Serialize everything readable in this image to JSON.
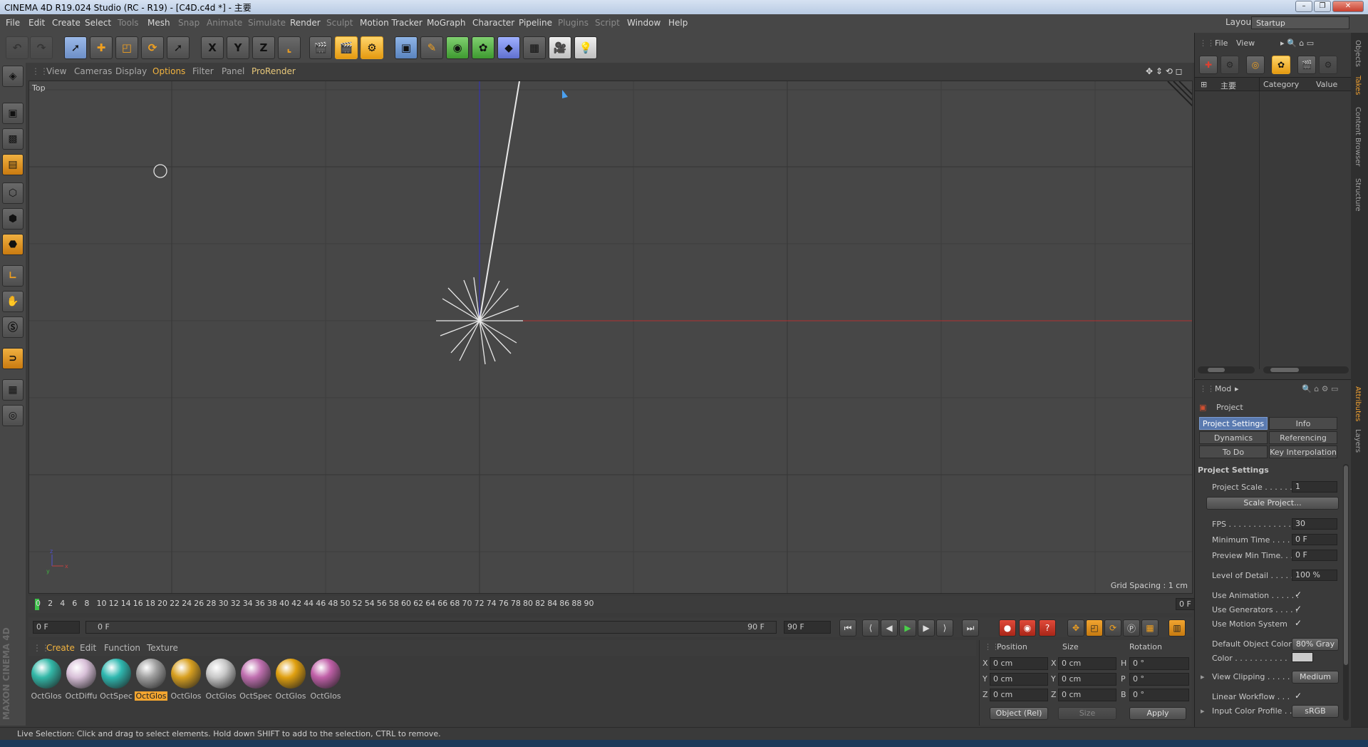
{
  "window": {
    "title": "CINEMA 4D R19.024 Studio (RC - R19) - [C4D.c4d *] - 主要"
  },
  "menu": [
    "File",
    "Edit",
    "Create",
    "Select",
    "Tools",
    "Mesh",
    "Snap",
    "Animate",
    "Simulate",
    "Render",
    "Sculpt",
    "Motion Tracker",
    "MoGraph",
    "Character",
    "Pipeline",
    "Plugins",
    "Script",
    "Window",
    "Help"
  ],
  "layout": {
    "label": "Layout:",
    "value": "Startup"
  },
  "toolbar": {
    "x": "X",
    "y": "Y",
    "z": "Z"
  },
  "viewport": {
    "menu": [
      "View",
      "Cameras",
      "Display",
      "Options",
      "Filter",
      "Panel",
      "ProRender"
    ],
    "label": "Top",
    "grid_spacing": "Grid Spacing : 1 cm",
    "axis_x_color": "#b03030",
    "axis_y_color": "#3030c0"
  },
  "timeline": {
    "ticks": [
      "0",
      "2",
      "4",
      "6",
      "8",
      "10",
      "12",
      "14",
      "16",
      "18",
      "20",
      "22",
      "24",
      "26",
      "28",
      "30",
      "32",
      "34",
      "36",
      "38",
      "40",
      "42",
      "44",
      "46",
      "48",
      "50",
      "52",
      "54",
      "56",
      "58",
      "60",
      "62",
      "64",
      "66",
      "68",
      "70",
      "72",
      "74",
      "76",
      "78",
      "80",
      "82",
      "84",
      "86",
      "88",
      "90"
    ],
    "current_frame": "0 F",
    "start": "0 F",
    "range_start": "0 F",
    "range_end": "90 F",
    "end": "90 F"
  },
  "material_menu": [
    "Create",
    "Edit",
    "Function",
    "Texture"
  ],
  "materials": [
    {
      "label": "OctGlos",
      "color": "#33b8a8",
      "selected": false
    },
    {
      "label": "OctDiffu",
      "color": "#d8c0d8",
      "selected": false
    },
    {
      "label": "OctSpec",
      "color": "#2fb8b0",
      "selected": false
    },
    {
      "label": "OctGlos",
      "color": "#a0a0a0",
      "selected": true
    },
    {
      "label": "OctGlos",
      "color": "#d8a020",
      "selected": false
    },
    {
      "label": "OctGlos",
      "color": "#c8c8c8",
      "selected": false
    },
    {
      "label": "OctSpec",
      "color": "#c070b0",
      "selected": false
    },
    {
      "label": "OctGlos",
      "color": "#e0a010",
      "selected": false
    },
    {
      "label": "OctGlos",
      "color": "#c060a8",
      "selected": false
    }
  ],
  "brand": "MAXON CINEMA 4D",
  "coords": {
    "headers": [
      "Position",
      "Size",
      "Rotation"
    ],
    "rows": [
      {
        "axis": "X",
        "pos": "0 cm",
        "size_axis": "X",
        "size": "0 cm",
        "rot_axis": "H",
        "rot": "0 °"
      },
      {
        "axis": "Y",
        "pos": "0 cm",
        "size_axis": "Y",
        "size": "0 cm",
        "rot_axis": "P",
        "rot": "0 °"
      },
      {
        "axis": "Z",
        "pos": "0 cm",
        "size_axis": "Z",
        "size": "0 cm",
        "rot_axis": "B",
        "rot": "0 °"
      }
    ],
    "mode": "Object (Rel)",
    "size_mode": "Size",
    "apply": "Apply"
  },
  "status": "Live Selection: Click and drag to select elements. Hold down SHIFT to add to the selection, CTRL to remove.",
  "objects": {
    "menu": [
      "File",
      "View"
    ],
    "root": "主要",
    "col_category": "Category",
    "col_value": "Value"
  },
  "attributes": {
    "mode": "Mod",
    "title": "Project",
    "tabs": [
      "Project Settings",
      "Info",
      "Dynamics",
      "Referencing",
      "To Do",
      "Key Interpolation"
    ],
    "section": "Project Settings",
    "project_scale_label": "Project Scale . . . . . .",
    "project_scale": "1",
    "scale_button": "Scale Project...",
    "fps_label": "FPS . . . . . . . . . . . . . . .",
    "fps": "30",
    "min_time_label": "Minimum Time . . . . .",
    "min_time": "0 F",
    "preview_min_label": "Preview Min Time. . . .",
    "preview_min": "0 F",
    "lod_label": "Level of Detail . . . . . .",
    "lod": "100 %",
    "use_animation": "Use Animation . . . . . .",
    "use_generators": "Use Generators . . . . .",
    "use_motion": "Use Motion System",
    "default_color_label": "Default Object Color",
    "default_color": "80% Gray",
    "color_label": "Color . . . . . . . . . . .",
    "view_clipping_label": "View Clipping . . . . . .",
    "view_clipping": "Medium",
    "linear_label": "Linear Workflow . . .",
    "input_profile_label": "Input Color Profile . .",
    "input_profile": "sRGB"
  },
  "side_tabs": [
    "Objects",
    "Takes",
    "Content Browser",
    "Structure",
    "Attributes",
    "Layers"
  ]
}
